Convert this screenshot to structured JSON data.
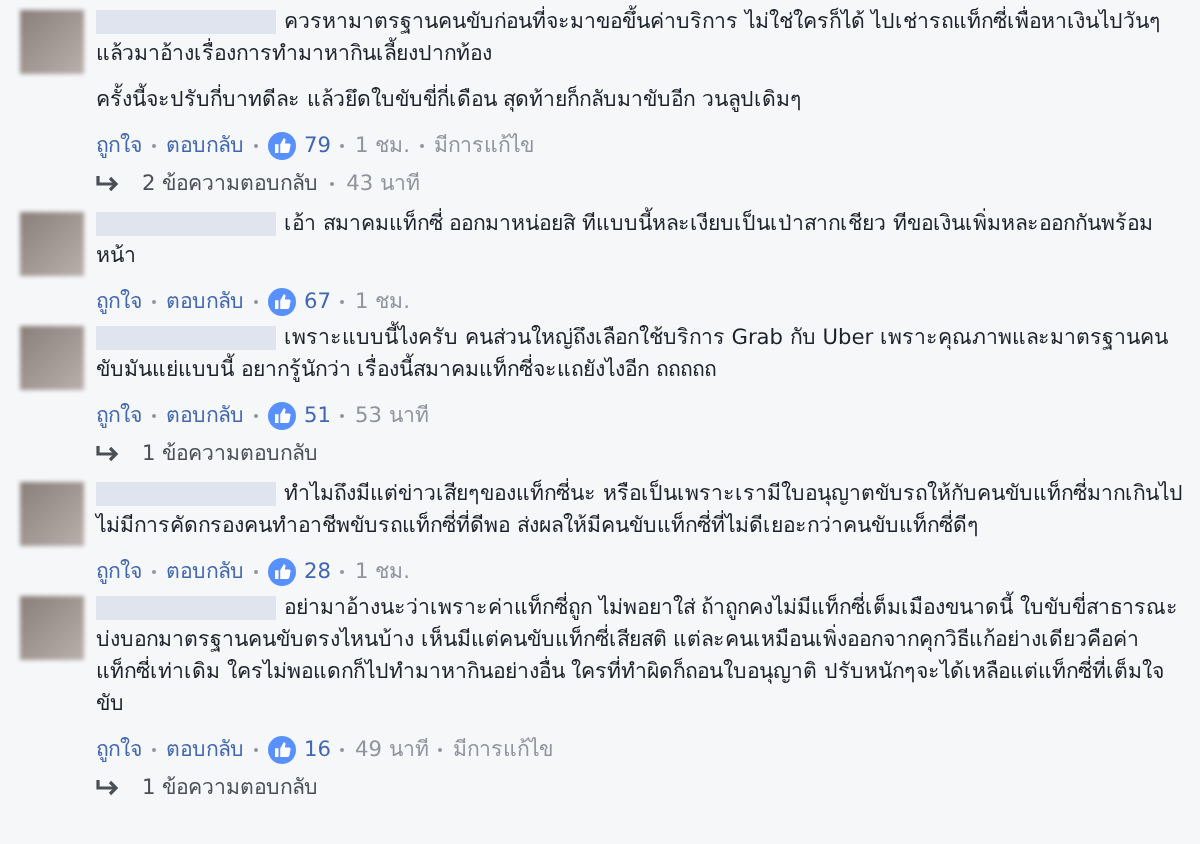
{
  "comments": [
    {
      "paragraphs": [
        "ควรหามาตรฐานคนขับก่อนที่จะมาขอขึ้นค่าบริการ ไม่ใช่ใครก็ได้ ไปเช่ารถแท็กซี่เพื่อหาเงินไปวันๆ แล้วมาอ้างเรื่องการทำมาหากินเลี้ยงปากท้อง",
        "ครั้งนี้จะปรับกี่บาทดีละ แล้วยึดใบขับขี่กี่เดือน สุดท้ายก็กลับมาขับอีก วนลูปเดิมๆ"
      ],
      "like": "ถูกใจ",
      "reply": "ตอบกลับ",
      "likes": "79",
      "time": "1 ชม.",
      "edited": "มีการแก้ไข",
      "replies": {
        "text": "2 ข้อความตอบกลับ",
        "time": "43 นาที"
      }
    },
    {
      "paragraphs": [
        "เอ้า สมาคมแท็กซี่ ออกมาหน่อยสิ ทีแบบนี้หละเงียบเป็นเป่าสากเชียว ทีขอเงินเพิ่มหละออกกันพร้อมหน้า"
      ],
      "like": "ถูกใจ",
      "reply": "ตอบกลับ",
      "likes": "67",
      "time": "1 ชม."
    },
    {
      "paragraphs": [
        "เพราะแบบนี้ไงครับ คนส่วนใหญ่ถึงเลือกใช้บริการ Grab กับ Uber เพราะคุณภาพและมาตรฐานคนขับมันแย่แบบนี้ อยากรู้นักว่า เรื่องนี้สมาคมแท็กซี่จะแถยังไงอีก ถถถถถ"
      ],
      "like": "ถูกใจ",
      "reply": "ตอบกลับ",
      "likes": "51",
      "time": "53 นาที",
      "replies": {
        "text": "1 ข้อความตอบกลับ"
      }
    },
    {
      "paragraphs": [
        "ทำไมถึงมีแต่ข่าวเสียๆของแท็กซี่นะ หรือเป็นเพราะเรามีใบอนุญาตขับรถให้กับคนขับแท็กซี่มากเกินไป ไม่มีการคัดกรองคนทำอาชีพขับรถแท็กซี่ที่ดีพอ ส่งผลให้มีคนขับแท็กซี่ที่ไม่ดีเยอะกว่าคนขับแท็กซี่ดีๆ"
      ],
      "like": "ถูกใจ",
      "reply": "ตอบกลับ",
      "likes": "28",
      "time": "1 ชม."
    },
    {
      "paragraphs": [
        "อย่ามาอ้างนะว่าเพราะค่าแท็กซี่ถูก ไม่พอยาใส่ ถ้าถูกคงไม่มีแท็กซี่เต็มเมืองขนาดนี้ ใบขับขี่สาธารณะบ่งบอกมาตรฐานคนขับตรงไหนบ้าง เห็นมีแต่คนขับแท็กซี่เสียสติ แต่ละคนเหมือนเพิ่งออกจากคุกวิธีแก้อย่างเดียวคือค่าแท็กซี่เท่าเดิม ใครไม่พอแดกก็ไปทำมาหากินอย่างอื่น ใครที่ทำผิดก็ถอนใบอนุญาติ ปรับหนักๆจะได้เหลือแต่แท็กซี่ที่เต็มใจขับ"
      ],
      "like": "ถูกใจ",
      "reply": "ตอบกลับ",
      "likes": "16",
      "time": "49 นาที",
      "edited": "มีการแก้ไข",
      "replies": {
        "text": "1 ข้อความตอบกลับ"
      }
    }
  ]
}
